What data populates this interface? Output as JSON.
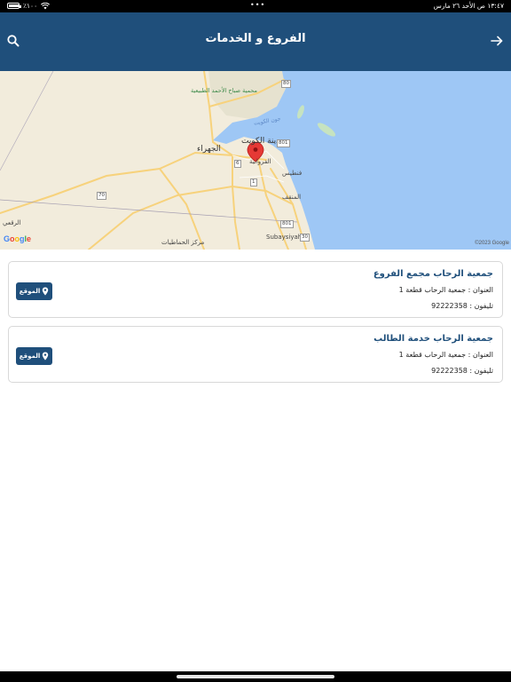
{
  "status_bar": {
    "datetime": "١٣:٤٧ ص  الأحد ٢٦ مارس",
    "battery": "٪١٠٠",
    "more_dots": "•••"
  },
  "header": {
    "title": "الفروع و الخدمات",
    "search_icon": "search-icon",
    "back_icon": "arrow-right-icon"
  },
  "map": {
    "labels": {
      "reserve": "محمية صباح الأحمد الطبيعية",
      "kuwait_city": "مدينة الكويت",
      "jahra": "الجهراء",
      "farwaniya": "الفروانية",
      "fintas": "فنطيس",
      "mangaf": "المنقف",
      "subaysiyah": "Subaysiyah",
      "riqqa": "الرقعي",
      "gas_center": "مركز الحماطيات",
      "bay": "جون الكويت"
    },
    "routes": [
      "80",
      "801",
      "70",
      "6",
      "1",
      "30",
      "801"
    ],
    "attribution_logo": "Google",
    "copyright": "©2023 Google",
    "colors": {
      "land": "#f2ecdc",
      "water": "#9ec7f5",
      "road": "#f7d27c",
      "pin": "#e53935"
    }
  },
  "branches": [
    {
      "name": "جمعية الرحاب  مجمع الفروع",
      "address": "العنوان : جمعية الرحاب قطعة 1",
      "phone": "تليفون : 92222358",
      "location_label": "الموقع"
    },
    {
      "name": "جمعية الرحاب خدمة الطالب",
      "address": "العنوان : جمعية الرحاب قطعة 1",
      "phone": "تليفون : 92222358",
      "location_label": "الموقع"
    }
  ],
  "colors": {
    "header_bg": "#1f4f7b",
    "accent": "#1f4f7b",
    "card_border": "#d8d8d8"
  }
}
